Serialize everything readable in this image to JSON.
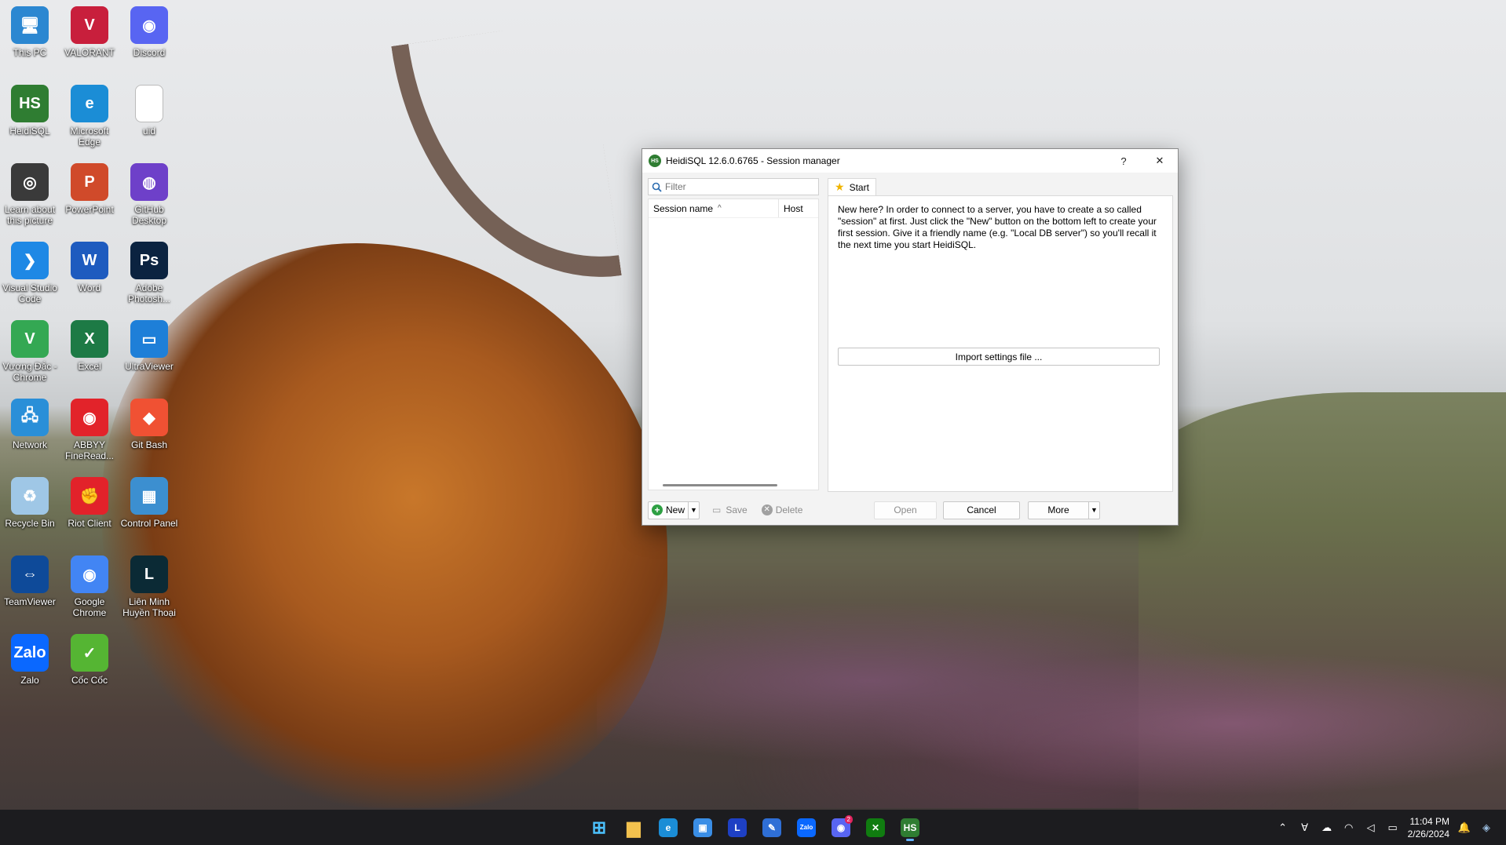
{
  "desktop": {
    "icons": [
      {
        "label": "This PC",
        "glyph": "🖥",
        "color": "#2b87d1"
      },
      {
        "label": "VALORANT",
        "glyph": "V",
        "color": "#c81f3c"
      },
      {
        "label": "Discord",
        "glyph": "◉",
        "color": "#5865f2"
      },
      {
        "label": "HeidiSQL",
        "glyph": "HS",
        "color": "#2f7d32"
      },
      {
        "label": "Microsoft Edge",
        "glyph": "e",
        "color": "#1b8dd6"
      },
      {
        "label": "uid",
        "glyph": "",
        "color": "#ffffff"
      },
      {
        "label": "Learn about this picture",
        "glyph": "◎",
        "color": "#3a3a3a"
      },
      {
        "label": "PowerPoint",
        "glyph": "P",
        "color": "#d04a2a"
      },
      {
        "label": "GitHub Desktop",
        "glyph": "◍",
        "color": "#6e40c9"
      },
      {
        "label": "Visual Studio Code",
        "glyph": "❯",
        "color": "#1e88e5"
      },
      {
        "label": "Word",
        "glyph": "W",
        "color": "#1e5bbf"
      },
      {
        "label": "Adobe Photosh...",
        "glyph": "Ps",
        "color": "#0b2340"
      },
      {
        "label": "Vương Đắc - Chrome",
        "glyph": "V",
        "color": "#34a853"
      },
      {
        "label": "Excel",
        "glyph": "X",
        "color": "#1d7a45"
      },
      {
        "label": "UltraViewer",
        "glyph": "▭",
        "color": "#1e7fd8"
      },
      {
        "label": "Network",
        "glyph": "🖧",
        "color": "#2a8fd8"
      },
      {
        "label": "ABBYY FineRead...",
        "glyph": "◉",
        "color": "#e2232a"
      },
      {
        "label": "Git Bash",
        "glyph": "◆",
        "color": "#f05133"
      },
      {
        "label": "Recycle Bin",
        "glyph": "♻",
        "color": "#9fc7e6"
      },
      {
        "label": "Riot Client",
        "glyph": "✊",
        "color": "#e2222a"
      },
      {
        "label": "Control Panel",
        "glyph": "▦",
        "color": "#3c8fd0"
      },
      {
        "label": "TeamViewer",
        "glyph": "⇔",
        "color": "#0e4a99"
      },
      {
        "label": "Google Chrome",
        "glyph": "◉",
        "color": "#4285f4"
      },
      {
        "label": "Liên Minh Huyền Thoại",
        "glyph": "L",
        "color": "#0b2a35"
      },
      {
        "label": "Zalo",
        "glyph": "Zalo",
        "color": "#0a68ff"
      },
      {
        "label": "Cốc Cốc",
        "glyph": "✓",
        "color": "#55b533"
      }
    ]
  },
  "dialog": {
    "title": "HeidiSQL 12.6.0.6765 - Session manager",
    "help_label": "?",
    "close_label": "✕",
    "filter_placeholder": "Filter",
    "columns": {
      "session_name": "Session name",
      "sort_indicator": "^",
      "host": "Host"
    },
    "tab_label": "Start",
    "intro_text": "New here? In order to connect to a server, you have to create a so called \"session\" at first. Just click the \"New\" button on the bottom left to create your first session. Give it a friendly name (e.g. \"Local DB server\") so you'll recall it the next time you start HeidiSQL.",
    "import_button": "Import settings file ...",
    "buttons": {
      "new": "New",
      "save": "Save",
      "delete": "Delete",
      "open": "Open",
      "cancel": "Cancel",
      "more": "More"
    }
  },
  "taskbar": {
    "apps": [
      {
        "name": "start",
        "glyph": "⊞",
        "color": "#4cc2ff"
      },
      {
        "name": "file-explorer",
        "glyph": "▆",
        "color": "#f2c14e"
      },
      {
        "name": "edge",
        "glyph": "e",
        "color": "#1b8dd6"
      },
      {
        "name": "store",
        "glyph": "▣",
        "color": "#3a8ee6"
      },
      {
        "name": "l-app",
        "glyph": "L",
        "color": "#1e40c4"
      },
      {
        "name": "writer",
        "glyph": "✎",
        "color": "#2f6fd6"
      },
      {
        "name": "zalo",
        "glyph": "Zalo",
        "color": "#0a68ff"
      },
      {
        "name": "discord",
        "glyph": "◉",
        "color": "#5865f2"
      },
      {
        "name": "xbox",
        "glyph": "✕",
        "color": "#107c10"
      },
      {
        "name": "heidisql",
        "glyph": "HS",
        "color": "#2f7d32"
      }
    ],
    "discord_badge": "2",
    "time": "11:04 PM",
    "date": "2/26/2024"
  }
}
